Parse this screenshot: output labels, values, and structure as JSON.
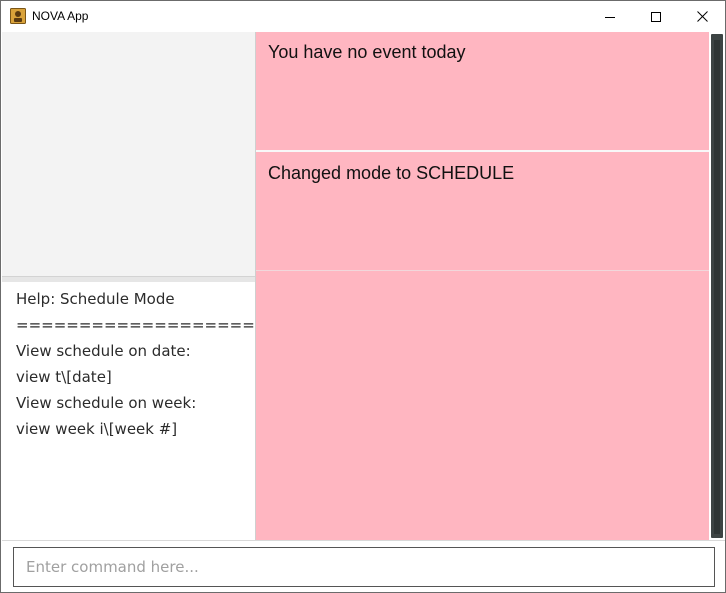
{
  "window": {
    "title": "NOVA App",
    "icon": "nova-app-icon",
    "controls": {
      "minimize": "minimize-icon",
      "maximize": "maximize-icon",
      "close": "close-icon"
    }
  },
  "help_panel": {
    "lines": [
      "Help: Schedule Mode",
      "===================",
      "View schedule on date:",
      "view t\\[date]",
      "View schedule on week:",
      "view week i\\[week #]"
    ]
  },
  "results": {
    "events_message": "You have no event today",
    "mode_message": "Changed mode to SCHEDULE"
  },
  "command": {
    "placeholder": "Enter command here...",
    "value": ""
  },
  "colors": {
    "result_background": "#ffb6c1",
    "left_top_background": "#f3f3f3",
    "scrollbar": "#3d4444"
  }
}
